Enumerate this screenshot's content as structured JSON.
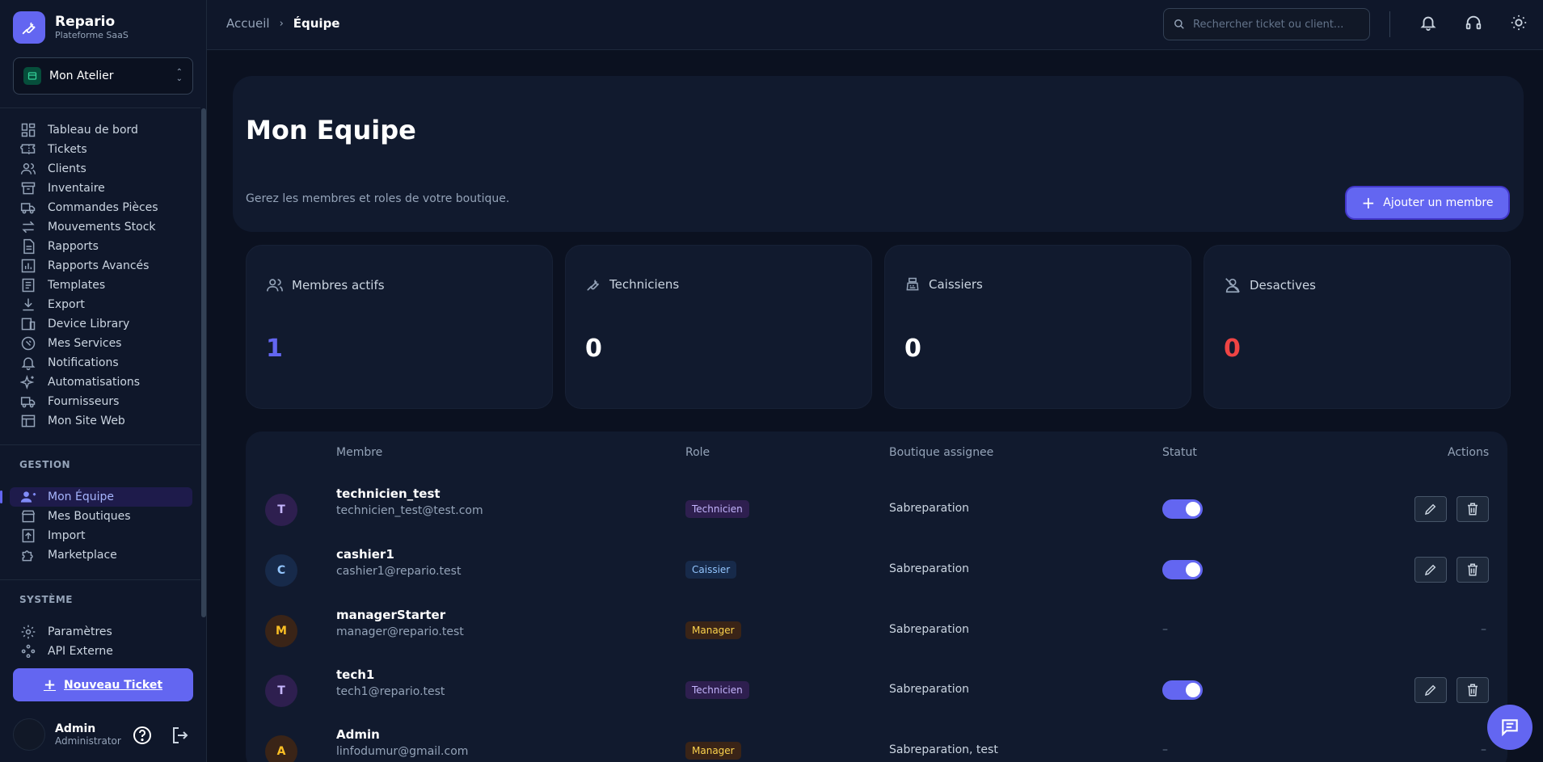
{
  "brand": {
    "name": "Repario",
    "subtitle": "Plateforme SaaS"
  },
  "shop_selector": {
    "value": "Mon Atelier"
  },
  "sidebar": {
    "main_items": [
      {
        "label": "Tableau de bord",
        "icon": "dashboard-icon"
      },
      {
        "label": "Tickets",
        "icon": "ticket-icon"
      },
      {
        "label": "Clients",
        "icon": "users-icon"
      },
      {
        "label": "Inventaire",
        "icon": "archive-icon"
      },
      {
        "label": "Commandes Pièces",
        "icon": "truck-icon"
      },
      {
        "label": "Mouvements Stock",
        "icon": "arrows-icon"
      },
      {
        "label": "Rapports",
        "icon": "document-icon"
      },
      {
        "label": "Rapports Avancés",
        "icon": "chart-icon"
      },
      {
        "label": "Templates",
        "icon": "template-icon"
      },
      {
        "label": "Export",
        "icon": "download-icon"
      },
      {
        "label": "Device Library",
        "icon": "devices-icon"
      },
      {
        "label": "Mes Services",
        "icon": "wrench-circle-icon"
      },
      {
        "label": "Notifications",
        "icon": "bell-icon"
      },
      {
        "label": "Automatisations",
        "icon": "sparkles-icon"
      },
      {
        "label": "Fournisseurs",
        "icon": "truck-icon"
      },
      {
        "label": "Mon Site Web",
        "icon": "website-icon"
      }
    ],
    "gestion_label": "GESTION",
    "gestion_items": [
      {
        "label": "Mon Équipe",
        "icon": "team-icon",
        "active": true
      },
      {
        "label": "Mes Boutiques",
        "icon": "store-icon"
      },
      {
        "label": "Import",
        "icon": "upload-icon"
      },
      {
        "label": "Marketplace",
        "icon": "puzzle-icon"
      }
    ],
    "systeme_label": "SYSTÈME",
    "systeme_items": [
      {
        "label": "Paramètres",
        "icon": "gear-icon"
      },
      {
        "label": "API Externe",
        "icon": "api-icon"
      }
    ],
    "new_ticket_label": "Nouveau Ticket",
    "user": {
      "name": "Admin",
      "role": "Administrator"
    }
  },
  "topbar": {
    "breadcrumb": [
      "Accueil",
      "Équipe"
    ],
    "search_placeholder": "Rechercher ticket ou client..."
  },
  "header": {
    "title": "Mon Equipe",
    "subtitle": "Gerez les membres et roles de votre boutique.",
    "add_button": "Ajouter un membre"
  },
  "stats": [
    {
      "label": "Membres actifs",
      "value": "1",
      "color": "#6366f1",
      "icon": "users-icon"
    },
    {
      "label": "Techniciens",
      "value": "0",
      "color": "#ffffff",
      "icon": "wrench-icon"
    },
    {
      "label": "Caissiers",
      "value": "0",
      "color": "#ffffff",
      "icon": "cash-register-icon"
    },
    {
      "label": "Desactives",
      "value": "0",
      "color": "#ef4444",
      "icon": "user-off-icon"
    }
  ],
  "table": {
    "headers": [
      "Membre",
      "Role",
      "Boutique assignee",
      "Statut",
      "Actions"
    ],
    "rows": [
      {
        "initial": "T",
        "name": "technicien_test",
        "email": "technicien_test@test.com",
        "role": "Technicien",
        "shop": "Sabreparation",
        "editable": true
      },
      {
        "initial": "C",
        "name": "cashier1",
        "email": "cashier1@repario.test",
        "role": "Caissier",
        "shop": "Sabreparation",
        "editable": true
      },
      {
        "initial": "M",
        "name": "managerStarter",
        "email": "manager@repario.test",
        "role": "Manager",
        "shop": "Sabreparation",
        "editable": false
      },
      {
        "initial": "T",
        "name": "tech1",
        "email": "tech1@repario.test",
        "role": "Technicien",
        "shop": "Sabreparation",
        "editable": true
      },
      {
        "initial": "A",
        "name": "Admin",
        "email": "linfodumur@gmail.com",
        "role": "Manager",
        "shop": "Sabreparation, test",
        "editable": false
      }
    ],
    "empty_mark": "–"
  },
  "colors": {
    "accent": "#6366f1",
    "danger": "#ef4444",
    "background": "#0b1120"
  }
}
